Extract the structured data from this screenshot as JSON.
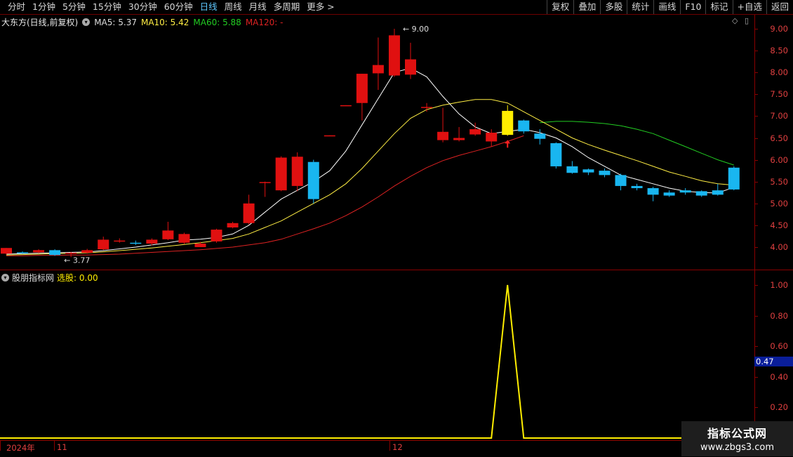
{
  "tabs": [
    "分时",
    "1分钟",
    "5分钟",
    "15分钟",
    "30分钟",
    "60分钟",
    "日线",
    "周线",
    "月线",
    "多周期",
    "更多 >"
  ],
  "active_tab": "日线",
  "tools": [
    "复权",
    "叠加",
    "多股",
    "统计",
    "画线",
    "F10",
    "标记",
    "+自选",
    "返回"
  ],
  "legend": {
    "stock": "大东方(日线,前复权)",
    "ma5": "MA5: 5.37",
    "ma10": "MA10: 5.42",
    "ma60": "MA60: 5.88",
    "ma120": "MA120: -"
  },
  "indicator_legend": {
    "name": "股朋指标网",
    "value": "选股: 0.00"
  },
  "price_ticks": [
    "9.00",
    "8.50",
    "8.00",
    "7.50",
    "7.00",
    "6.50",
    "6.00",
    "5.50",
    "5.00",
    "4.50",
    "4.00"
  ],
  "ind_ticks": [
    "1.00",
    "0.80",
    "0.60",
    "0.40",
    "0.20"
  ],
  "current_value": "0.47",
  "annotations": {
    "high": "9.00",
    "low": "3.77"
  },
  "x_labels": [
    "2024年",
    "11",
    "12"
  ],
  "watermark": {
    "title": "指标公式网",
    "url": "www.zbgs3.com"
  },
  "colors": {
    "up": "#e01010",
    "down": "#19b6f0",
    "signal": "#ffee00",
    "ma5": "#ffffff",
    "ma10": "#ffee44",
    "ma60": "#22cc22",
    "ma120": "#dd2222"
  },
  "chart_data": {
    "type": "candlestick",
    "candles": [
      {
        "o": 3.85,
        "c": 3.98,
        "h": 3.98,
        "l": 3.83
      },
      {
        "o": 3.88,
        "c": 3.87,
        "h": 3.9,
        "l": 3.85
      },
      {
        "o": 3.88,
        "c": 3.93,
        "h": 3.95,
        "l": 3.86
      },
      {
        "o": 3.93,
        "c": 3.82,
        "h": 3.95,
        "l": 3.8
      },
      {
        "o": 3.86,
        "c": 3.87,
        "h": 3.89,
        "l": 3.77
      },
      {
        "o": 3.87,
        "c": 3.93,
        "h": 3.96,
        "l": 3.85
      },
      {
        "o": 3.95,
        "c": 4.17,
        "h": 4.24,
        "l": 3.93
      },
      {
        "o": 4.13,
        "c": 4.15,
        "h": 4.2,
        "l": 4.1
      },
      {
        "o": 4.1,
        "c": 4.08,
        "h": 4.15,
        "l": 4.05
      },
      {
        "o": 4.08,
        "c": 4.17,
        "h": 4.2,
        "l": 4.04
      },
      {
        "o": 4.18,
        "c": 4.38,
        "h": 4.58,
        "l": 4.16
      },
      {
        "o": 4.1,
        "c": 4.3,
        "h": 4.33,
        "l": 4.07
      },
      {
        "o": 4.0,
        "c": 4.08,
        "h": 4.12,
        "l": 4.0
      },
      {
        "o": 4.13,
        "c": 4.4,
        "h": 4.42,
        "l": 4.1
      },
      {
        "o": 4.45,
        "c": 4.55,
        "h": 4.58,
        "l": 4.43
      },
      {
        "o": 4.55,
        "c": 5.0,
        "h": 5.2,
        "l": 4.52
      },
      {
        "o": 5.48,
        "c": 5.49,
        "h": 5.5,
        "l": 5.15
      },
      {
        "o": 5.3,
        "c": 6.05,
        "h": 6.08,
        "l": 5.28
      },
      {
        "o": 5.4,
        "c": 6.07,
        "h": 6.17,
        "l": 5.28
      },
      {
        "o": 5.95,
        "c": 5.1,
        "h": 6.0,
        "l": 5.0
      },
      {
        "o": 6.55,
        "c": 6.56,
        "h": 6.56,
        "l": 6.54
      },
      {
        "o": 7.24,
        "c": 7.25,
        "h": 7.25,
        "l": 7.24
      },
      {
        "o": 7.3,
        "c": 7.97,
        "h": 7.97,
        "l": 6.9
      },
      {
        "o": 7.98,
        "c": 8.17,
        "h": 8.8,
        "l": 7.6
      },
      {
        "o": 7.93,
        "c": 8.85,
        "h": 9.0,
        "l": 7.9
      },
      {
        "o": 7.95,
        "c": 8.3,
        "h": 8.68,
        "l": 7.85
      },
      {
        "o": 7.2,
        "c": 7.21,
        "h": 7.3,
        "l": 7.1
      },
      {
        "o": 6.45,
        "c": 6.64,
        "h": 7.19,
        "l": 6.4
      },
      {
        "o": 6.45,
        "c": 6.5,
        "h": 6.75,
        "l": 6.42
      },
      {
        "o": 6.58,
        "c": 6.7,
        "h": 6.85,
        "l": 6.55
      },
      {
        "o": 6.42,
        "c": 6.62,
        "h": 6.7,
        "l": 6.3
      },
      {
        "o": 6.57,
        "c": 7.12,
        "h": 7.25,
        "l": 6.55,
        "signal": true
      },
      {
        "o": 6.9,
        "c": 6.65,
        "h": 6.92,
        "l": 6.6
      },
      {
        "o": 6.6,
        "c": 6.48,
        "h": 6.7,
        "l": 6.35
      },
      {
        "o": 6.38,
        "c": 5.85,
        "h": 6.4,
        "l": 5.8
      },
      {
        "o": 5.85,
        "c": 5.7,
        "h": 5.97,
        "l": 5.68
      },
      {
        "o": 5.78,
        "c": 5.71,
        "h": 5.8,
        "l": 5.65
      },
      {
        "o": 5.75,
        "c": 5.65,
        "h": 5.8,
        "l": 5.6
      },
      {
        "o": 5.65,
        "c": 5.4,
        "h": 5.68,
        "l": 5.3
      },
      {
        "o": 5.4,
        "c": 5.35,
        "h": 5.45,
        "l": 5.3
      },
      {
        "o": 5.35,
        "c": 5.2,
        "h": 5.38,
        "l": 5.05
      },
      {
        "o": 5.25,
        "c": 5.18,
        "h": 5.3,
        "l": 5.15
      },
      {
        "o": 5.3,
        "c": 5.25,
        "h": 5.35,
        "l": 5.2
      },
      {
        "o": 5.28,
        "c": 5.18,
        "h": 5.3,
        "l": 5.15
      },
      {
        "o": 5.3,
        "c": 5.2,
        "h": 5.45,
        "l": 5.18
      },
      {
        "o": 5.82,
        "c": 5.32,
        "h": 5.85,
        "l": 5.3
      }
    ],
    "ma5": [
      3.84,
      3.85,
      3.86,
      3.87,
      3.88,
      3.89,
      3.92,
      3.96,
      4.0,
      4.05,
      4.1,
      4.16,
      4.18,
      4.22,
      4.3,
      4.5,
      4.8,
      5.1,
      5.3,
      5.5,
      5.75,
      6.2,
      6.8,
      7.4,
      8.0,
      8.1,
      7.9,
      7.45,
      7.05,
      6.75,
      6.6,
      6.65,
      6.7,
      6.62,
      6.5,
      6.3,
      6.05,
      5.85,
      5.65,
      5.55,
      5.45,
      5.35,
      5.28,
      5.25,
      5.24,
      5.37
    ],
    "ma10": [
      3.82,
      3.83,
      3.84,
      3.85,
      3.86,
      3.87,
      3.89,
      3.92,
      3.95,
      3.98,
      4.02,
      4.06,
      4.1,
      4.15,
      4.2,
      4.3,
      4.45,
      4.6,
      4.8,
      5.0,
      5.2,
      5.45,
      5.8,
      6.2,
      6.6,
      6.95,
      7.15,
      7.25,
      7.32,
      7.38,
      7.38,
      7.3,
      7.1,
      6.9,
      6.7,
      6.5,
      6.35,
      6.22,
      6.1,
      5.98,
      5.85,
      5.72,
      5.62,
      5.52,
      5.45,
      5.42
    ],
    "ma60": [
      null,
      null,
      null,
      null,
      null,
      null,
      null,
      null,
      null,
      null,
      null,
      null,
      null,
      null,
      null,
      null,
      null,
      null,
      null,
      null,
      null,
      null,
      null,
      null,
      null,
      null,
      null,
      null,
      null,
      null,
      null,
      null,
      null,
      6.85,
      6.88,
      6.88,
      6.86,
      6.83,
      6.78,
      6.7,
      6.6,
      6.45,
      6.3,
      6.15,
      6.0,
      5.88
    ],
    "ma120": [
      3.8,
      3.8,
      3.81,
      3.81,
      3.82,
      3.82,
      3.83,
      3.84,
      3.86,
      3.88,
      3.9,
      3.92,
      3.94,
      3.97,
      4.0,
      4.05,
      4.1,
      4.18,
      4.3,
      4.42,
      4.55,
      4.72,
      4.92,
      5.15,
      5.4,
      5.62,
      5.82,
      5.98,
      6.1,
      6.2,
      6.3,
      6.42,
      6.55
    ],
    "indicator": [
      0,
      0,
      0,
      0,
      0,
      0,
      0,
      0,
      0,
      0,
      0,
      0,
      0,
      0,
      0,
      0,
      0,
      0,
      0,
      0,
      0,
      0,
      0,
      0,
      0,
      0,
      0,
      0,
      0,
      0,
      0,
      1,
      0,
      0,
      0,
      0,
      0,
      0,
      0,
      0,
      0,
      0,
      0,
      0,
      0,
      0
    ],
    "price_range": [
      3.6,
      9.3
    ],
    "indicator_range": [
      0,
      1.05
    ]
  }
}
